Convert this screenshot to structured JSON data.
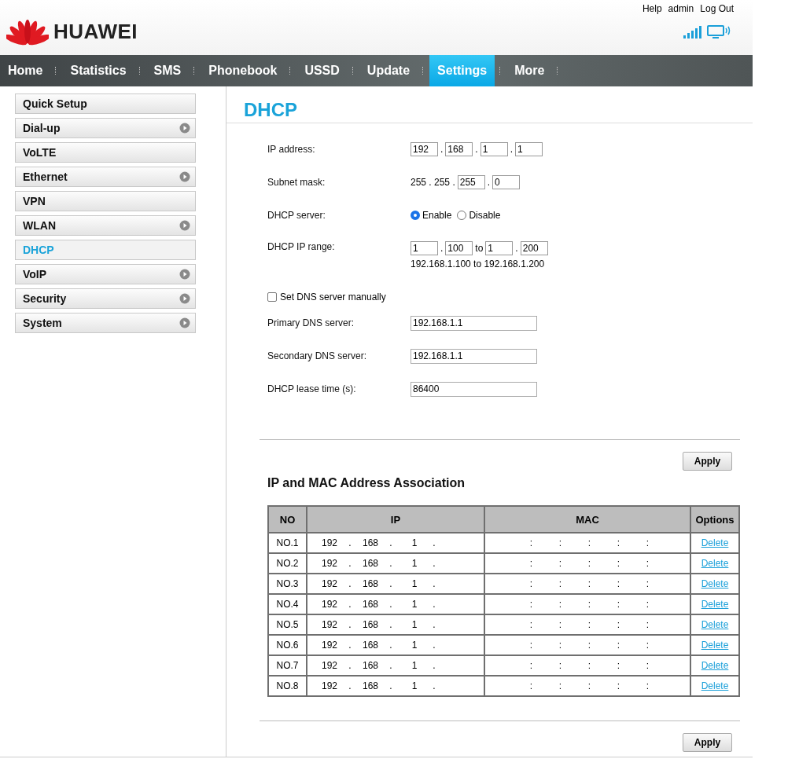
{
  "header": {
    "links": [
      "Help",
      "admin",
      "Log Out"
    ],
    "logo_text": "HUAWEI"
  },
  "nav": [
    {
      "label": "Home",
      "selected": false
    },
    {
      "label": "Statistics",
      "selected": false
    },
    {
      "label": "SMS",
      "selected": false
    },
    {
      "label": "Phonebook",
      "selected": false
    },
    {
      "label": "USSD",
      "selected": false
    },
    {
      "label": "Update",
      "selected": false
    },
    {
      "label": "Settings",
      "selected": true
    },
    {
      "label": "More",
      "selected": false
    }
  ],
  "sidebar": [
    {
      "label": "Quick Setup",
      "selected": false,
      "expandable": false
    },
    {
      "label": "Dial-up",
      "selected": false,
      "expandable": true
    },
    {
      "label": "VoLTE",
      "selected": false,
      "expandable": false
    },
    {
      "label": "Ethernet",
      "selected": false,
      "expandable": true
    },
    {
      "label": "VPN",
      "selected": false,
      "expandable": false
    },
    {
      "label": "WLAN",
      "selected": false,
      "expandable": true
    },
    {
      "label": "DHCP",
      "selected": true,
      "expandable": false
    },
    {
      "label": "VoIP",
      "selected": false,
      "expandable": true
    },
    {
      "label": "Security",
      "selected": false,
      "expandable": true
    },
    {
      "label": "System",
      "selected": false,
      "expandable": true
    }
  ],
  "title": "DHCP",
  "form": [
    {
      "kind": "octets",
      "label": "IP address:",
      "parts": [
        {
          "kind": "input",
          "value": "192"
        },
        {
          "kind": "sep",
          "text": "."
        },
        {
          "kind": "input",
          "value": "168"
        },
        {
          "kind": "sep",
          "text": "."
        },
        {
          "kind": "input",
          "value": "1"
        },
        {
          "kind": "sep",
          "text": "."
        },
        {
          "kind": "input",
          "value": "1"
        }
      ]
    },
    {
      "kind": "octets",
      "label": "Subnet mask:",
      "parts": [
        {
          "kind": "sep",
          "text": "255 . 255 ."
        },
        {
          "kind": "input",
          "value": "255"
        },
        {
          "kind": "sep",
          "text": "."
        },
        {
          "kind": "input",
          "value": "0"
        }
      ]
    },
    {
      "kind": "radio",
      "label": "DHCP server:",
      "options": [
        {
          "label": "Enable",
          "selected": true
        },
        {
          "label": "Disable",
          "selected": false
        }
      ]
    },
    {
      "kind": "range",
      "label": "DHCP IP range:",
      "parts": [
        {
          "kind": "input",
          "value": "1"
        },
        {
          "kind": "sep",
          "text": "."
        },
        {
          "kind": "input",
          "value": "100"
        },
        {
          "kind": "sep",
          "text": "to"
        },
        {
          "kind": "input",
          "value": "1"
        },
        {
          "kind": "sep",
          "text": "."
        },
        {
          "kind": "input",
          "value": "200"
        }
      ],
      "note": "192.168.1.100 to 192.168.1.200"
    },
    {
      "kind": "checkbox",
      "label": "Set DNS server manually",
      "checked": false
    },
    {
      "kind": "text",
      "label": "Primary DNS server:",
      "value": "192.168.1.1"
    },
    {
      "kind": "text",
      "label": "Secondary DNS server:",
      "value": "192.168.1.1"
    },
    {
      "kind": "text",
      "label": "DHCP lease time (s):",
      "value": "86400"
    }
  ],
  "apply_top": "Apply",
  "table": {
    "title": "IP and MAC Address Association",
    "columns": [
      "NO",
      "IP",
      "MAC",
      "Options"
    ],
    "rows": [
      {
        "no": "NO.1",
        "ip": [
          "192",
          ".",
          "168",
          ".",
          "1",
          "."
        ],
        "mac": [
          ":",
          ":",
          ":",
          ":",
          ":"
        ],
        "action": "Delete"
      },
      {
        "no": "NO.2",
        "ip": [
          "192",
          ".",
          "168",
          ".",
          "1",
          "."
        ],
        "mac": [
          ":",
          ":",
          ":",
          ":",
          ":"
        ],
        "action": "Delete"
      },
      {
        "no": "NO.3",
        "ip": [
          "192",
          ".",
          "168",
          ".",
          "1",
          "."
        ],
        "mac": [
          ":",
          ":",
          ":",
          ":",
          ":"
        ],
        "action": "Delete"
      },
      {
        "no": "NO.4",
        "ip": [
          "192",
          ".",
          "168",
          ".",
          "1",
          "."
        ],
        "mac": [
          ":",
          ":",
          ":",
          ":",
          ":"
        ],
        "action": "Delete"
      },
      {
        "no": "NO.5",
        "ip": [
          "192",
          ".",
          "168",
          ".",
          "1",
          "."
        ],
        "mac": [
          ":",
          ":",
          ":",
          ":",
          ":"
        ],
        "action": "Delete"
      },
      {
        "no": "NO.6",
        "ip": [
          "192",
          ".",
          "168",
          ".",
          "1",
          "."
        ],
        "mac": [
          ":",
          ":",
          ":",
          ":",
          ":"
        ],
        "action": "Delete"
      },
      {
        "no": "NO.7",
        "ip": [
          "192",
          ".",
          "168",
          ".",
          "1",
          "."
        ],
        "mac": [
          ":",
          ":",
          ":",
          ":",
          ":"
        ],
        "action": "Delete"
      },
      {
        "no": "NO.8",
        "ip": [
          "192",
          ".",
          "168",
          ".",
          "1",
          "."
        ],
        "mac": [
          ":",
          ":",
          ":",
          ":",
          ":"
        ],
        "action": "Delete"
      }
    ]
  },
  "apply_bottom": "Apply"
}
